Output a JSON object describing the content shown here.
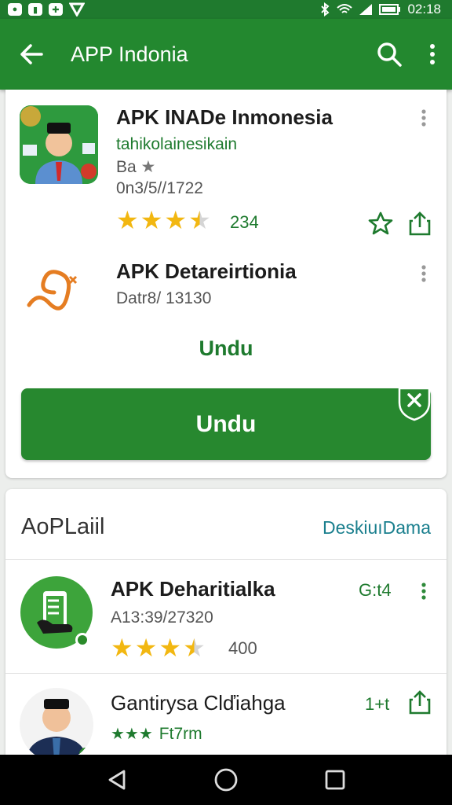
{
  "status_bar": {
    "time": "02:18",
    "left_icons": [
      "messenger-icon",
      "notification-icon",
      "photo-icon",
      "play-icon"
    ],
    "right_icons": [
      "bluetooth-icon",
      "wifi-icon",
      "signal-icon",
      "battery-icon"
    ]
  },
  "app_bar": {
    "title": "APP Indonia",
    "back_icon": "arrow-back-icon",
    "search_icon": "search-icon",
    "more_icon": "more-vert-icon"
  },
  "card1": {
    "item1": {
      "title": "APK INADe Inmonesia",
      "subtitle": "tahikolainesikain",
      "meta": "Ba",
      "date": "0n3/5//1722",
      "rating": 3.5,
      "rating_count": "234"
    },
    "item2": {
      "title": "APK Detareirtionia",
      "date": "Datr8/ 13130"
    },
    "link_label": "Undu",
    "button_label": "Undu"
  },
  "card2": {
    "section_title": "AoPLaiil",
    "section_link": "DeskiuıDama",
    "item1": {
      "title": "APK Deharitialka",
      "date": "A13:39/27320",
      "badge": "G:t4",
      "rating": 3.5,
      "rating_count": "400"
    },
    "item2": {
      "title": "Gantirysa Clďiahga",
      "rating_text": "Ft7rm",
      "badge": "1+t"
    }
  },
  "colors": {
    "app_bar": "#23882f",
    "status_bar": "#1f7a2e",
    "accent_green": "#1e7a2e",
    "star": "#f2b711",
    "link_teal": "#1a7f8e"
  },
  "nav_bar": {
    "back_icon": "nav-back-icon",
    "home_icon": "nav-home-icon",
    "recents_icon": "nav-recents-icon"
  }
}
